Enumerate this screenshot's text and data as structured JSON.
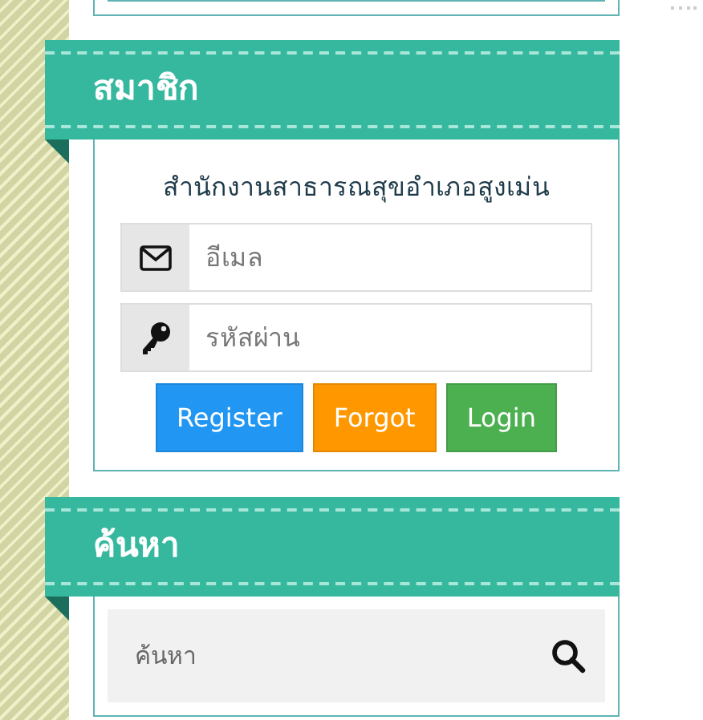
{
  "sections": [
    {
      "kind": "login",
      "title": "สมาชิก",
      "subtitle": "สำนักงานสาธารณสุขอำเภอสูงเม่น",
      "fields": [
        {
          "kind": "email",
          "placeholder": "อีเมล"
        },
        {
          "kind": "password",
          "placeholder": "รหัสผ่าน"
        }
      ],
      "buttons": [
        {
          "label": "Register",
          "color": "#2196f3"
        },
        {
          "label": "Forgot",
          "color": "#ff9800"
        },
        {
          "label": "Login",
          "color": "#4caf50"
        }
      ]
    },
    {
      "kind": "search",
      "title": "ค้นหา",
      "placeholder": "ค้นหา"
    }
  ]
}
